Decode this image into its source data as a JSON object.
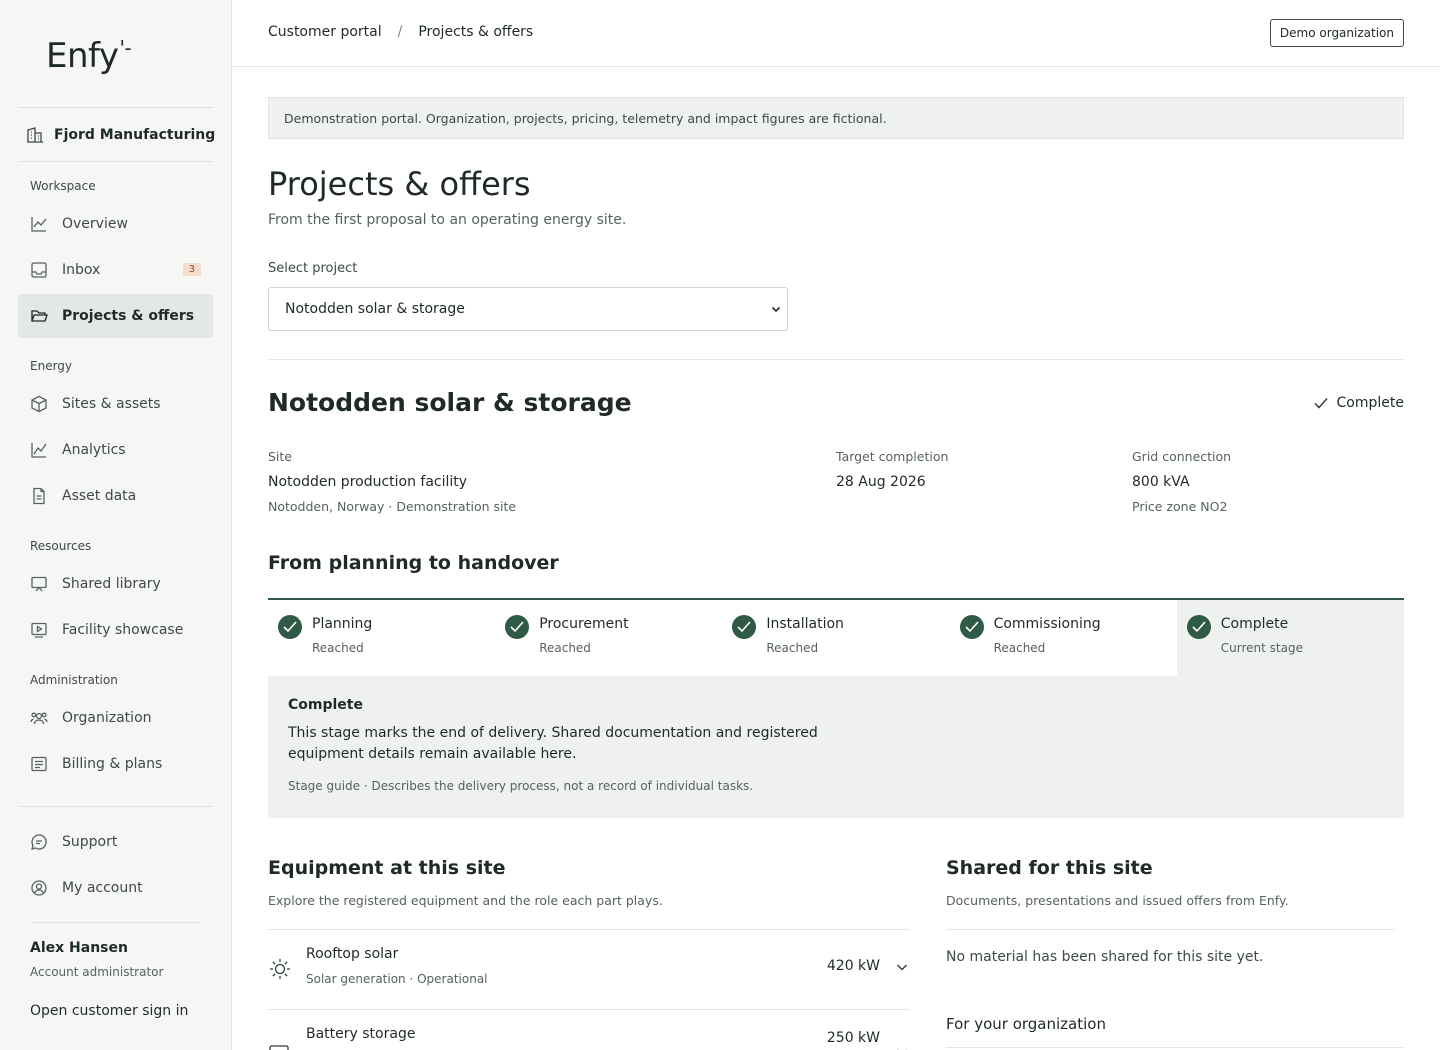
{
  "app": {
    "logo": "Enfy"
  },
  "sidebar": {
    "organization": "Fjord Manufacturing",
    "sections": {
      "workspace": "Workspace",
      "energy": "Energy",
      "resources": "Resources",
      "administration": "Administration"
    },
    "items": {
      "overview": "Overview",
      "inbox": "Inbox",
      "inbox_badge": "3",
      "projects": "Projects & offers",
      "sites": "Sites & assets",
      "analytics": "Analytics",
      "asset_data": "Asset data",
      "shared_library": "Shared library",
      "facility_showcase": "Facility showcase",
      "organization": "Organization",
      "billing": "Billing & plans",
      "support": "Support",
      "my_account": "My account"
    },
    "user": {
      "name": "Alex Hansen",
      "role": "Account administrator"
    },
    "sign_in_link": "Open customer sign in",
    "accent": "#2f5a47"
  },
  "header": {
    "breadcrumb": [
      "Customer portal",
      "/",
      "Projects & offers"
    ],
    "org_button": "Demo organization"
  },
  "main": {
    "notice": "Demonstration portal. Organization, projects, pricing, telemetry and impact figures are fictional.",
    "title": "Projects & offers",
    "subtitle": "From the first proposal to an operating energy site.",
    "select_label": "Select project",
    "selected_project": "Notodden solar & storage",
    "project": {
      "name": "Notodden solar & storage",
      "status": "Complete",
      "site_label": "Site",
      "site_value": "Notodden production facility",
      "site_sub": "Notodden, Norway · Demonstration site",
      "target_label": "Target completion",
      "target_value": "28 Aug 2026",
      "grid_label": "Grid connection",
      "grid_value": "800 kVA",
      "grid_sub": "Price zone NO2"
    },
    "timeline": {
      "heading": "From planning to handover",
      "steps": [
        {
          "name": "Planning",
          "state": "Reached"
        },
        {
          "name": "Procurement",
          "state": "Reached"
        },
        {
          "name": "Installation",
          "state": "Reached"
        },
        {
          "name": "Commissioning",
          "state": "Reached"
        },
        {
          "name": "Complete",
          "state": "Current stage"
        }
      ],
      "detail_title": "Complete",
      "detail_text": "This stage marks the end of delivery. Shared documentation and registered equipment details remain available here.",
      "detail_guide": "Stage guide · Describes the delivery process, not a record of individual tasks."
    },
    "equipment": {
      "heading": "Equipment at this site",
      "subtitle": "Explore the registered equipment and the role each part plays.",
      "items": [
        {
          "name": "Rooftop solar",
          "desc": "Solar generation · Operational",
          "power": "420 kW",
          "icon": "sun-icon"
        },
        {
          "name": "Battery storage",
          "desc": "",
          "power": "250 kW",
          "icon": "battery-icon"
        }
      ]
    },
    "shared": {
      "heading": "Shared for this site",
      "subtitle": "Documents, presentations and issued offers from Enfy.",
      "empty": "No material has been shared for this site yet.",
      "org_heading": "For your organization"
    }
  }
}
